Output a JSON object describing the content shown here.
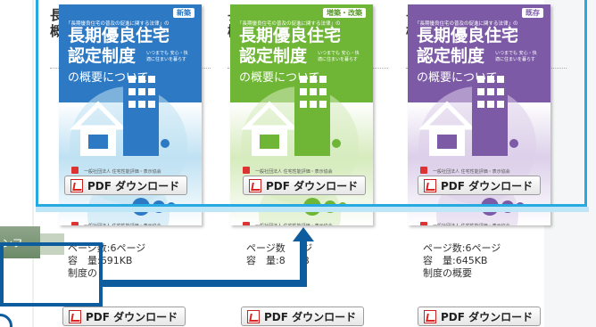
{
  "background_headings": {
    "col1": [
      "長",
      "概",
      "〔令"
    ],
    "col2": [
      "長",
      "概",
      "〔令"
    ],
    "col2_edition": "版〕",
    "col3": [
      "長",
      "概",
      "〔令"
    ]
  },
  "cards": [
    {
      "badge": "新築",
      "subtitle_small": "「長期優良住宅の普及の促進に関する法律」の",
      "title": "長期優良住宅\n認定制度",
      "title_note": "いつまでも 安心・快適に住まいを暮らす",
      "outline": "の概要について",
      "footer": "一般社団法人 住宅性能評価・表示協会",
      "button_label": "PDF ダウンロード",
      "pages": "ページ数:6ページ",
      "size": "容　量:691KB",
      "note": "制度の",
      "bottom_button_label": "PDF ダウンロード",
      "colors": {
        "top": "#2d79c4",
        "bottom": "#bfe1f3",
        "badge_text": "#2d79c4"
      }
    },
    {
      "badge": "増築・改築",
      "subtitle_small": "「長期優良住宅の普及の促進に関する法律」の",
      "title": "長期優良住宅\n認定制度",
      "title_note": "いつまでも 安心・快適に住まいを暮らす",
      "outline": "の概要について",
      "footer": "一般社団法人 住宅性能評価・表示協会",
      "button_label": "PDF ダウンロード",
      "pages": "ページ数",
      "pages_tail": "ジ",
      "size": "容　量:8",
      "size_tail": "B",
      "note": "",
      "bottom_button_label": "PDF ダウンロード",
      "colors": {
        "top": "#6fb536",
        "bottom": "#d6ebbd",
        "badge_text": "#5a9a2c"
      }
    },
    {
      "badge": "既存",
      "subtitle_small": "「長期優良住宅の普及の促進に関する法律」の",
      "title": "長期優良住宅\n認定制度",
      "title_note": "いつまでも 安心・快適に住まいを暮らす",
      "outline": "の概要について",
      "footer": "一般社団法人 住宅性能評価・表示協会",
      "button_label": "PDF ダウンロード",
      "pages": "ページ数:6ページ",
      "size": "容　量:645KB",
      "note": "制度の概要",
      "bottom_button_label": "PDF ダウンロード",
      "colors": {
        "top": "#7c5aa6",
        "bottom": "#dcd0ea",
        "badge_text": "#7c5aa6"
      }
    }
  ],
  "side_tab": {
    "label": "ンフ"
  },
  "highlight": {
    "border_color": "#27a9e1",
    "arrow_color": "#0d5c9e"
  }
}
